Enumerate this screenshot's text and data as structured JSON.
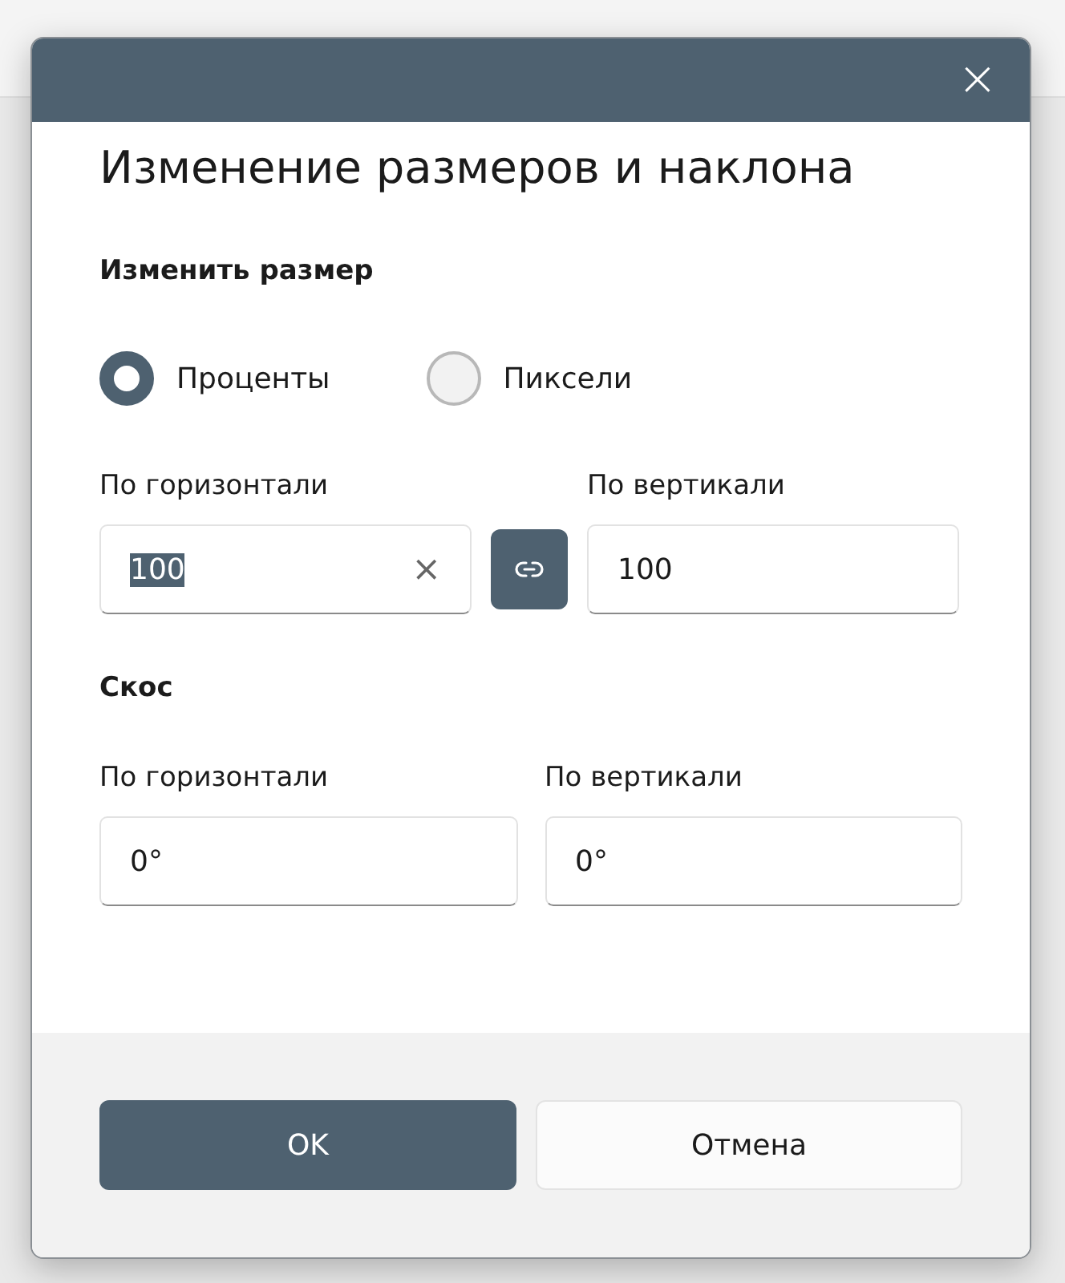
{
  "dialog": {
    "title": "Изменение размеров и наклона",
    "close": "×"
  },
  "resize": {
    "heading": "Изменить размер",
    "modes": [
      {
        "label": "Проценты",
        "selected": true
      },
      {
        "label": "Пиксели",
        "selected": false
      }
    ],
    "horizontal": {
      "label": "По горизонтали",
      "value": "100",
      "text_selected": true,
      "clear": "×"
    },
    "vertical": {
      "label": "По вертикали",
      "value": "100",
      "text_selected": false
    }
  },
  "skew": {
    "heading": "Скос",
    "horizontal": {
      "label": "По горизонтали",
      "value": "0°"
    },
    "vertical": {
      "label": "По вертикали",
      "value": "0°"
    }
  },
  "buttons": [
    {
      "label": "OK",
      "kind": "primary"
    },
    {
      "label": "Отмена",
      "kind": "secondary"
    }
  ]
}
